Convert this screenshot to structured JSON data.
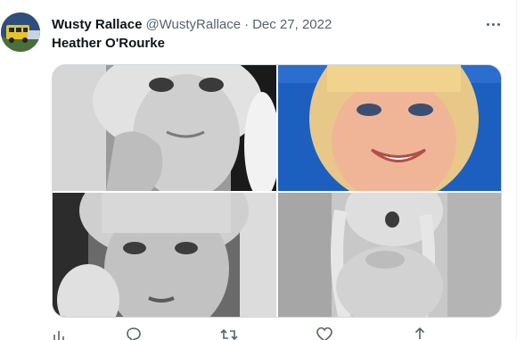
{
  "tweet": {
    "display_name": "Wusty Rallace",
    "handle": "@WustyRallace",
    "separator": "·",
    "date": "Dec 27, 2022",
    "text": "Heather O'Rourke"
  },
  "media": {
    "photos": [
      {
        "name": "photo-1",
        "tone": "grayscale"
      },
      {
        "name": "photo-2",
        "tone": "color"
      },
      {
        "name": "photo-3",
        "tone": "grayscale"
      },
      {
        "name": "photo-4",
        "tone": "grayscale"
      }
    ]
  },
  "actions": [
    "analytics-icon",
    "reply-icon",
    "retweet-icon",
    "like-icon",
    "share-icon"
  ],
  "colors": {
    "text_primary": "#0f1419",
    "text_secondary": "#536471",
    "border": "#cfd9de",
    "photo2_background": "#1d5fbf"
  }
}
